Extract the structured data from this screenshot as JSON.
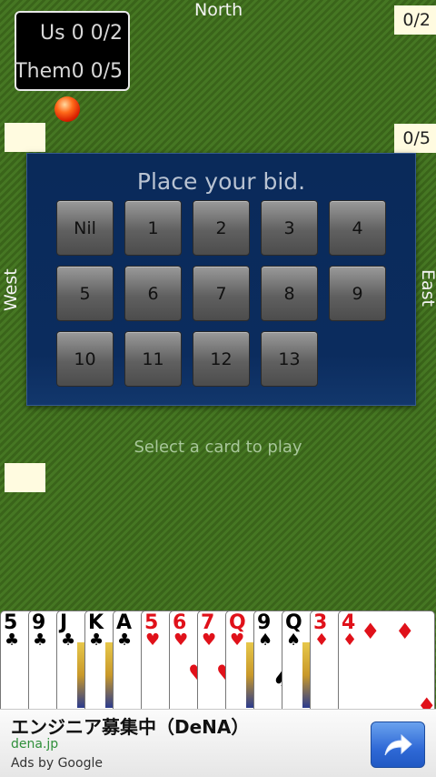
{
  "score": {
    "us_label": "Us",
    "us_points": "0",
    "us_bags": "0/2",
    "them_label": "Them",
    "them_points": "0",
    "them_bags": "0/5"
  },
  "players": {
    "north": "North",
    "west": "West",
    "east": "East"
  },
  "tallies": {
    "north": "0/2",
    "east": "0/5",
    "west": "",
    "south": ""
  },
  "bid": {
    "title": "Place your bid.",
    "options": [
      "Nil",
      "1",
      "2",
      "3",
      "4",
      "5",
      "6",
      "7",
      "8",
      "9",
      "10",
      "11",
      "12",
      "13"
    ]
  },
  "hint": "Select a card to play",
  "hand": [
    {
      "rank": "5",
      "suit": "♣",
      "color": "black"
    },
    {
      "rank": "9",
      "suit": "♣",
      "color": "black"
    },
    {
      "rank": "J",
      "suit": "♣",
      "color": "black"
    },
    {
      "rank": "K",
      "suit": "♣",
      "color": "black"
    },
    {
      "rank": "A",
      "suit": "♣",
      "color": "black"
    },
    {
      "rank": "5",
      "suit": "♥",
      "color": "red"
    },
    {
      "rank": "6",
      "suit": "♥",
      "color": "red"
    },
    {
      "rank": "7",
      "suit": "♥",
      "color": "red"
    },
    {
      "rank": "Q",
      "suit": "♥",
      "color": "red"
    },
    {
      "rank": "9",
      "suit": "♠",
      "color": "black"
    },
    {
      "rank": "Q",
      "suit": "♠",
      "color": "black"
    },
    {
      "rank": "3",
      "suit": "♦",
      "color": "red"
    },
    {
      "rank": "4",
      "suit": "♦",
      "color": "red"
    }
  ],
  "ad": {
    "headline": "エンジニア募集中（DeNA）",
    "url": "dena.jp",
    "attribution": "Ads by Google",
    "button_icon": "share-arrow-icon"
  }
}
